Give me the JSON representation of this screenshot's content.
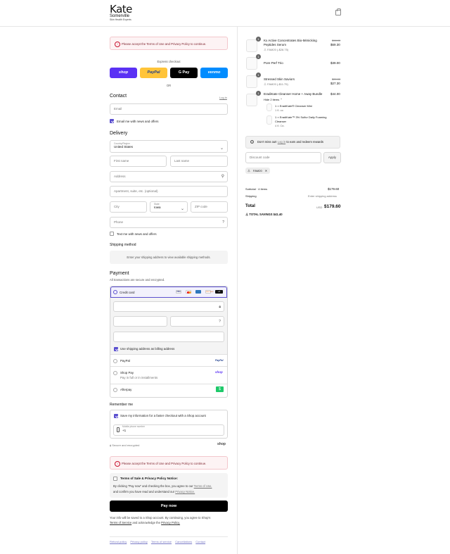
{
  "brand": {
    "name": "Kate",
    "sub": "Somerville",
    "tagline": "Skin Health Experts"
  },
  "error_banner": "Please accept the Terms of Use and Privacy Policy to continue.",
  "express": {
    "title": "Express checkout",
    "shop": "shop",
    "paypal": "PayPal",
    "gpay": "G Pay",
    "venmo": "venmo",
    "or": "OR"
  },
  "contact": {
    "title": "Contact",
    "login": "Log in",
    "email_placeholder": "Email",
    "news_label": "Email me with news and offers"
  },
  "delivery": {
    "title": "Delivery",
    "country_label": "Country/Region",
    "country_value": "United States",
    "first": "First name",
    "last": "Last name",
    "address": "Address",
    "apt": "Apartment, suite, etc. (optional)",
    "city": "City",
    "state_label": "State",
    "state_value": "Iowa",
    "zip": "ZIP code",
    "phone": "Phone",
    "text_label": "Text me with news and offers"
  },
  "shipping": {
    "title": "Shipping method",
    "placeholder": "Enter your shipping address to view available shipping methods."
  },
  "payment": {
    "title": "Payment",
    "subtitle": "All transactions are secure and encrypted.",
    "credit_card": "Credit card",
    "more_cards": "+4",
    "billing_label": "Use shipping address as billing address",
    "paypal": "PayPal",
    "shoppay": "Shop Pay",
    "shoppay_sub": "Pay in full or in installments",
    "afterpay": "Afterpay",
    "card_labels": {
      "visa": "VISA",
      "discover": "DISCOVER",
      "shop_logo": "shop",
      "paypal_logo": "PayPal",
      "afterpay_logo": "$"
    }
  },
  "remember": {
    "title": "Remember me",
    "save_label": "Save my information for a faster checkout with a Shop account",
    "phone_label": "Mobile phone number",
    "phone_value": "+1",
    "secure": "Secure and encrypted",
    "shop_logo": "shop"
  },
  "terms": {
    "title": "Terms of Sale & Privacy Policy Notice:",
    "text1": "By clicking \"Pay now\" and checking the box, you agree to our",
    "link1": "Terms of Use,",
    "text2": "and confirm you have read and understand our",
    "link2": "Privacy Notice."
  },
  "paynow": "Pay now",
  "footer_note": {
    "text": "Your info will be saved to a Shop account. By continuing, you agree to Shop's",
    "tos": "Terms of Service",
    "and": "and acknowledge the",
    "pp": "Privacy Policy."
  },
  "footer_links": [
    "Refund policy",
    "Privacy policy",
    "Terms of service",
    "Cancellations",
    "Contact"
  ],
  "items": [
    {
      "qty": "1",
      "name": "Kx Active Concentrates Bio-Mimicking",
      "name2": "Peptides Serum",
      "code": "FAM20 (-$28.75)",
      "old": "$98.00",
      "price": "$69.30"
    },
    {
      "qty": "1",
      "name": "Pore Perf Trio",
      "price": "$39.00"
    },
    {
      "qty": "1",
      "name": "Stressed Skin Saviors",
      "code": "FAM20 (-$11.75)",
      "old": "$39.00",
      "price": "$27.30"
    },
    {
      "qty": "1",
      "name": "EradiKate Cleanser Home + Away Bundle",
      "price": "$44.00",
      "toggle": "Hide 2 items",
      "subs": [
        {
          "name": "1 × EradiKate® Cleanser Mini",
          "size": "1 fl. oz."
        },
        {
          "name": "1 × EradiKate™ 3% Sulfur Daily Foaming",
          "name2": "Cleanser",
          "size": "4 fl. Oz."
        }
      ]
    }
  ],
  "rewards": {
    "text1": "Don't miss out!",
    "link": "Log in",
    "text2": "to earn and redeem rewards"
  },
  "discount": {
    "placeholder": "Discount code",
    "apply": "Apply",
    "code": "FAM20"
  },
  "summary": {
    "subtotal_label": "Subtotal · 4 items",
    "subtotal": "$179.60",
    "shipping_label": "Shipping",
    "shipping": "Enter shipping address",
    "total_label": "Total",
    "currency": "USD",
    "total": "$179.60",
    "savings_label": "TOTAL SAVINGS",
    "savings": "$41.40"
  },
  "colors": {
    "accent": "#5a4fcf",
    "shop": "#5a31f4",
    "paypal": "#ffc439",
    "venmo": "#008cff",
    "afterpay": "#b2fce4"
  }
}
